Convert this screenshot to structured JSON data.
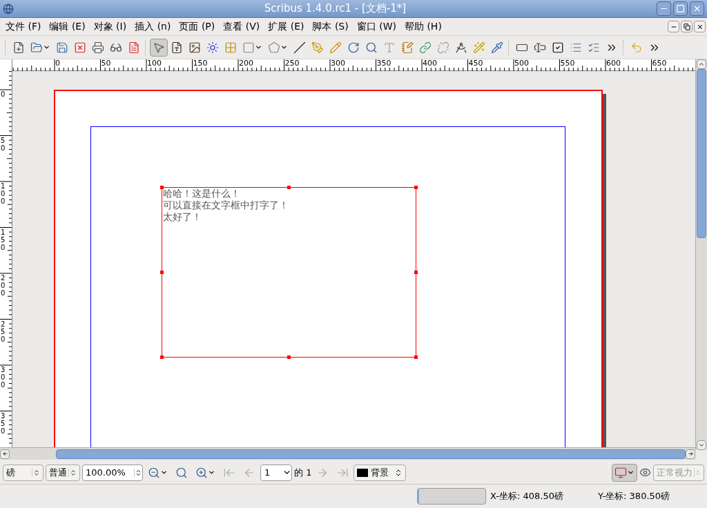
{
  "window": {
    "title": "Scribus 1.4.0.rc1 - [文档-1*]"
  },
  "menu": [
    "文件 (F)",
    "编辑 (E)",
    "对象 (I)",
    "插入 (n)",
    "页面 (P)",
    "查看 (V)",
    "扩展 (E)",
    "脚本 (S)",
    "窗口 (W)",
    "帮助 (H)"
  ],
  "ruler": {
    "horizontal": [
      "0",
      "50",
      "100",
      "150",
      "200",
      "250",
      "300",
      "350",
      "400",
      "450",
      "500",
      "550",
      "600",
      "650"
    ],
    "vertical": [
      "0",
      "50",
      "100",
      "150",
      "200",
      "250",
      "300",
      "350"
    ]
  },
  "text_frame": {
    "selected": true,
    "lines": [
      "哈哈！这是什么！",
      "可以直接在文字框中打字了！",
      "太好了！"
    ]
  },
  "bottom_bar": {
    "unit": "磅",
    "quality": "普通",
    "zoom": "100.00%",
    "page": "1",
    "page_of": "的 1",
    "layer": {
      "name": "背景",
      "color": "#000000"
    },
    "vision": {
      "value": "正常视力",
      "disabled": true
    }
  },
  "status_bar": {
    "progress": {
      "level": 0
    },
    "x": "X-坐标: 408.50磅",
    "y": "Y-坐标: 380.50磅"
  }
}
